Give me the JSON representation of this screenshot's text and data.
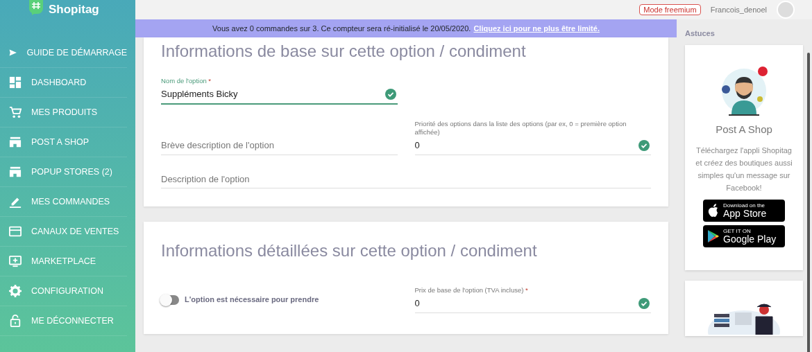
{
  "logo": {
    "text": "Shopitag"
  },
  "sidebar": {
    "items": [
      {
        "label": "GUIDE DE DÉMARRAGE"
      },
      {
        "label": "DASHBOARD"
      },
      {
        "label": "MES PRODUITS"
      },
      {
        "label": "POST A SHOP"
      },
      {
        "label": "POPUP STORES (2)"
      },
      {
        "label": "MES COMMANDES"
      },
      {
        "label": "CANAUX DE VENTES"
      },
      {
        "label": "MARKETPLACE"
      },
      {
        "label": "CONFIGURATION"
      },
      {
        "label": "ME DÉCONNECTER"
      }
    ]
  },
  "top_bar": {
    "plan_badge": "Mode freemium",
    "username": "Francois_denoel"
  },
  "banner": {
    "message": "Vous avez 0 commandes sur 3. Ce compteur sera ré-initialisé le 20/05/2020.",
    "link": "Cliquez ici pour ne plus être limité."
  },
  "sections": [
    {
      "title": "Informations de base sur cette option / condiment",
      "rows": [
        [
          {
            "kind": "text",
            "label": "Nom de l'option",
            "required_mark": "*",
            "value": "Suppléments Bicky",
            "valid": true
          }
        ],
        [
          {
            "kind": "text",
            "placeholder": "Brève description de l'option"
          },
          {
            "kind": "text",
            "label": "Priorité des options dans la liste des options (par ex, 0 = première option affichée)",
            "value": "0",
            "valid": true
          }
        ],
        [
          {
            "kind": "text",
            "placeholder": "Description de l'option"
          }
        ]
      ]
    },
    {
      "title": "Informations détaillées sur cette option / condiment",
      "rows": [
        [
          {
            "kind": "switch",
            "label": "L'option est nécessaire pour prendre",
            "on": false
          },
          {
            "kind": "text",
            "label": "Prix de base de l'option (TVA incluse)",
            "required_mark": "*",
            "value": "0",
            "valid": true
          }
        ]
      ]
    }
  ],
  "tips": {
    "title": "Astuces",
    "cards": [
      {
        "kind": "promo",
        "title": "Post A Shop",
        "text": "Téléchargez l'appli Shopitag et créez des boutiques aussi simples qu'un message sur Facebook!",
        "stores": [
          {
            "kind": "apple",
            "small": "Download on the",
            "big": "App Store"
          },
          {
            "kind": "google",
            "small": "GET IT ON",
            "big": "Google Play"
          }
        ]
      },
      {
        "kind": "illustration"
      }
    ]
  }
}
